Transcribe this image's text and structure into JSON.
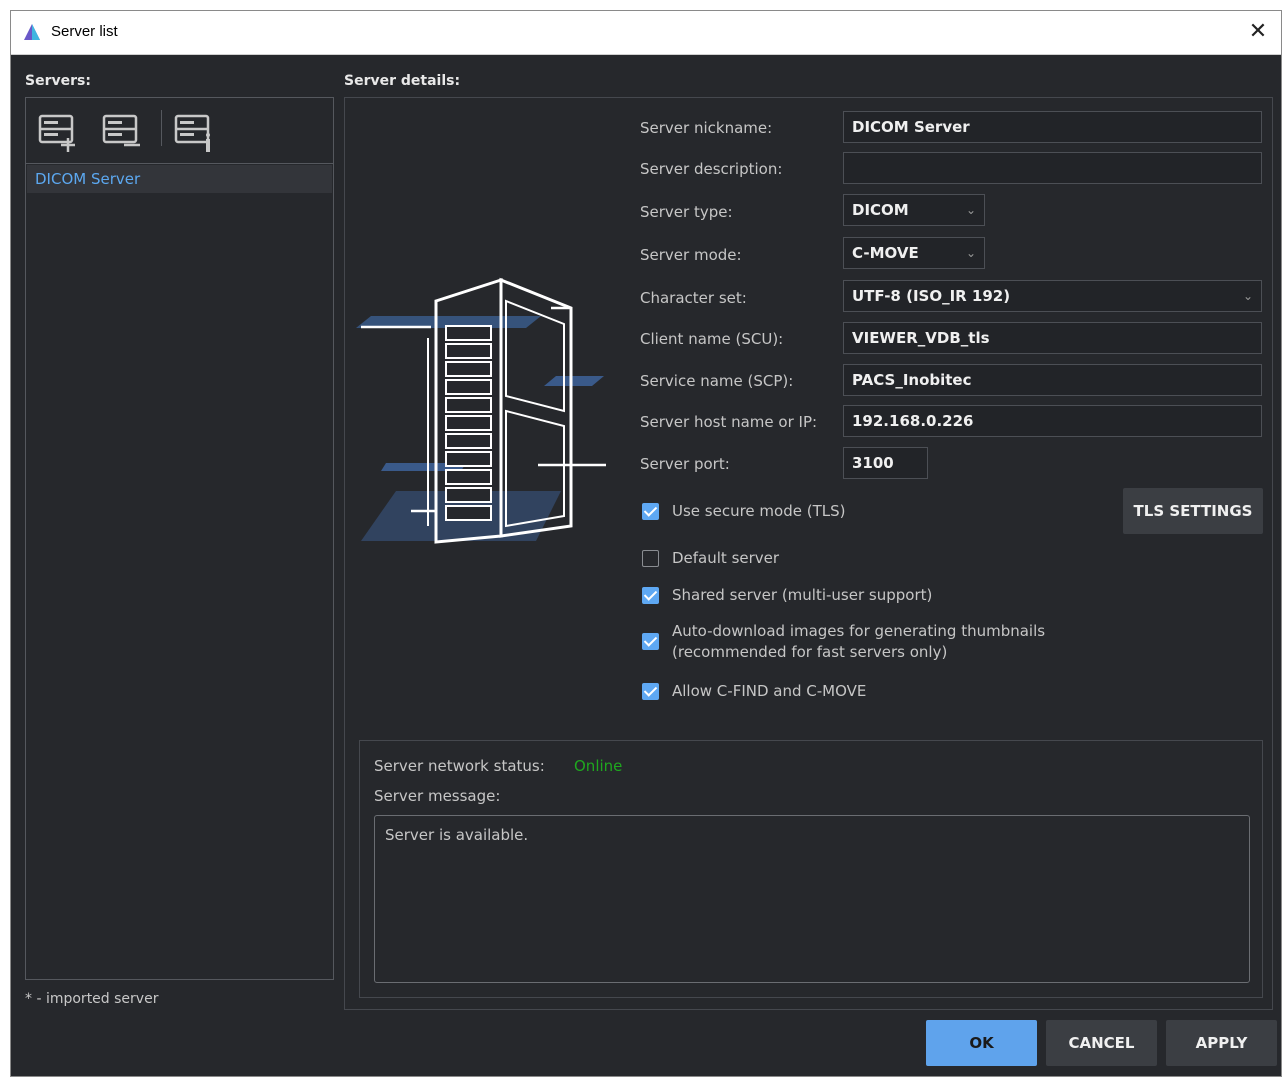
{
  "window": {
    "title": "Server list",
    "close_glyph": "✕"
  },
  "servers": {
    "heading": "Servers:",
    "toolbar": [
      "add-server-icon",
      "remove-server-icon",
      "server-info-icon"
    ],
    "items": [
      {
        "label": "DICOM Server"
      }
    ],
    "footnote": "* - imported server"
  },
  "details": {
    "heading": "Server details:",
    "fields": {
      "nickname": {
        "label": "Server nickname:",
        "value": "DICOM Server"
      },
      "description": {
        "label": "Server description:",
        "value": ""
      },
      "type": {
        "label": "Server type:",
        "value": "DICOM"
      },
      "mode": {
        "label": "Server mode:",
        "value": "C-MOVE"
      },
      "charset": {
        "label": "Character set:",
        "value": "UTF-8 (ISO_IR 192)"
      },
      "client_name": {
        "label": "Client name (SCU):",
        "value": "VIEWER_VDB_tls"
      },
      "service_name": {
        "label": "Service name (SCP):",
        "value": "PACS_Inobitec"
      },
      "host": {
        "label": "Server host name or IP:",
        "value": "192.168.0.226"
      },
      "port": {
        "label": "Server port:",
        "value": "3100"
      }
    },
    "checks": {
      "tls": {
        "label": "Use secure mode (TLS)",
        "checked": true
      },
      "default": {
        "label": "Default server",
        "checked": false
      },
      "shared": {
        "label": "Shared server (multi-user support)",
        "checked": true
      },
      "autodownload": {
        "label_line1": "Auto-download images for generating thumbnails",
        "label_line2": "(recommended for fast servers only)",
        "checked": true
      },
      "cfind": {
        "label": "Allow C-FIND and C-MOVE",
        "checked": true
      }
    },
    "tls_button": "TLS SETTINGS",
    "illustration": "server-rack-illustration"
  },
  "status": {
    "network_label": "Server network status:",
    "network_value": "Online",
    "network_color": "#1fa81f",
    "message_label": "Server message:",
    "message": "Server is available."
  },
  "buttons": {
    "ok": "OK",
    "cancel": "CANCEL",
    "apply": "APPLY"
  },
  "colors": {
    "accent": "#5ea8f3",
    "background": "#26282c",
    "selected_text": "#5ca8f0"
  }
}
